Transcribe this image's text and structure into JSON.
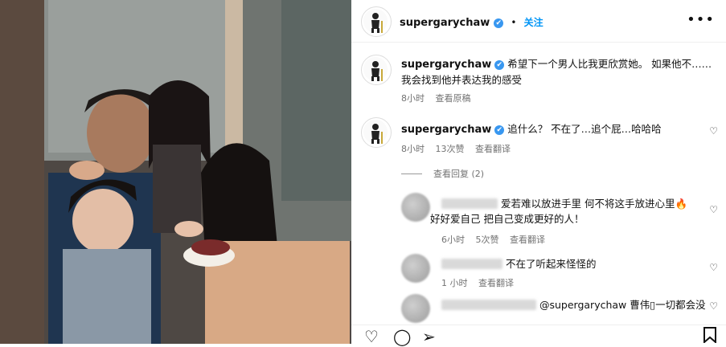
{
  "post": {
    "username": "supergarychaw",
    "verified_mark": "✔",
    "separator": "•",
    "follow_label": "关注",
    "more_icon": "more-horizontal-icon"
  },
  "caption": {
    "username": "supergarychaw",
    "text_line1": "希望下一个男人比我更欣赏她。 如果他不……",
    "text_line2": "我会找到他并表达我的感受",
    "time": "8小时",
    "translate": "查看原稿"
  },
  "comments": [
    {
      "username": "supergarychaw",
      "text": "追什么？ 不在了…追个屁…哈哈哈",
      "time": "8小时",
      "likes": "13次赞",
      "translate": "查看翻译"
    }
  ],
  "view_replies": "查看回复 (2)",
  "replies": [
    {
      "text_line1": "爱若难以放进手里 何不将这手放进心里🔥",
      "text_line2": "好好爱自己 把自己变成更好的人！",
      "time": "6小时",
      "likes": "5次赞",
      "translate": "查看翻译"
    },
    {
      "text": "不在了听起来怪怪的",
      "time": "1 小时",
      "translate": "查看翻译"
    },
    {
      "text": "@supergarychaw 曹伟▯一切都会没"
    }
  ],
  "icons": {
    "like": "heart-icon",
    "comment": "comment-icon",
    "share": "share-icon",
    "save": "bookmark-icon"
  }
}
